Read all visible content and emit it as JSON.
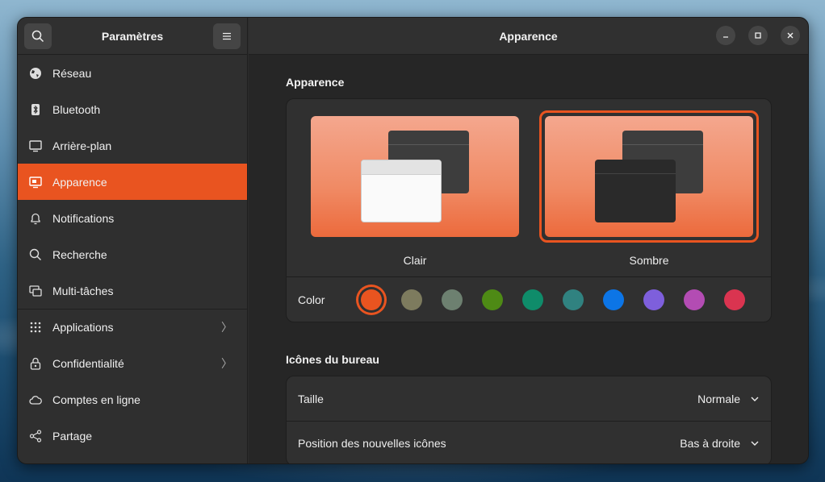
{
  "sidebar": {
    "title": "Paramètres",
    "items": [
      {
        "label": "Réseau",
        "icon": "globe-icon"
      },
      {
        "label": "Bluetooth",
        "icon": "bluetooth-icon"
      },
      {
        "label": "Arrière-plan",
        "icon": "monitor-icon"
      },
      {
        "label": "Apparence",
        "icon": "appearance-icon",
        "active": true
      },
      {
        "label": "Notifications",
        "icon": "bell-icon"
      },
      {
        "label": "Recherche",
        "icon": "search-icon"
      },
      {
        "label": "Multi-tâches",
        "icon": "multitask-icon"
      },
      {
        "label": "Applications",
        "icon": "grid-icon",
        "chevron": true
      },
      {
        "label": "Confidentialité",
        "icon": "lock-icon",
        "chevron": true
      },
      {
        "label": "Comptes en ligne",
        "icon": "cloud-icon"
      },
      {
        "label": "Partage",
        "icon": "share-icon"
      }
    ]
  },
  "header": {
    "title": "Apparence"
  },
  "appearance": {
    "section_title": "Apparence",
    "themes": [
      {
        "label": "Clair",
        "selected": false
      },
      {
        "label": "Sombre",
        "selected": true
      }
    ],
    "color_label": "Color",
    "colors": [
      "#e95420",
      "#7d7b5e",
      "#6d8070",
      "#4e8a15",
      "#0f8c6a",
      "#308280",
      "#0c75e6",
      "#7e5fdc",
      "#b34cb3",
      "#da3450"
    ],
    "selected_color": "#e95420"
  },
  "desktop_icons": {
    "section_title": "Icônes du bureau",
    "rows": [
      {
        "label": "Taille",
        "value": "Normale"
      },
      {
        "label": "Position des nouvelles icônes",
        "value": "Bas à droite"
      }
    ]
  }
}
